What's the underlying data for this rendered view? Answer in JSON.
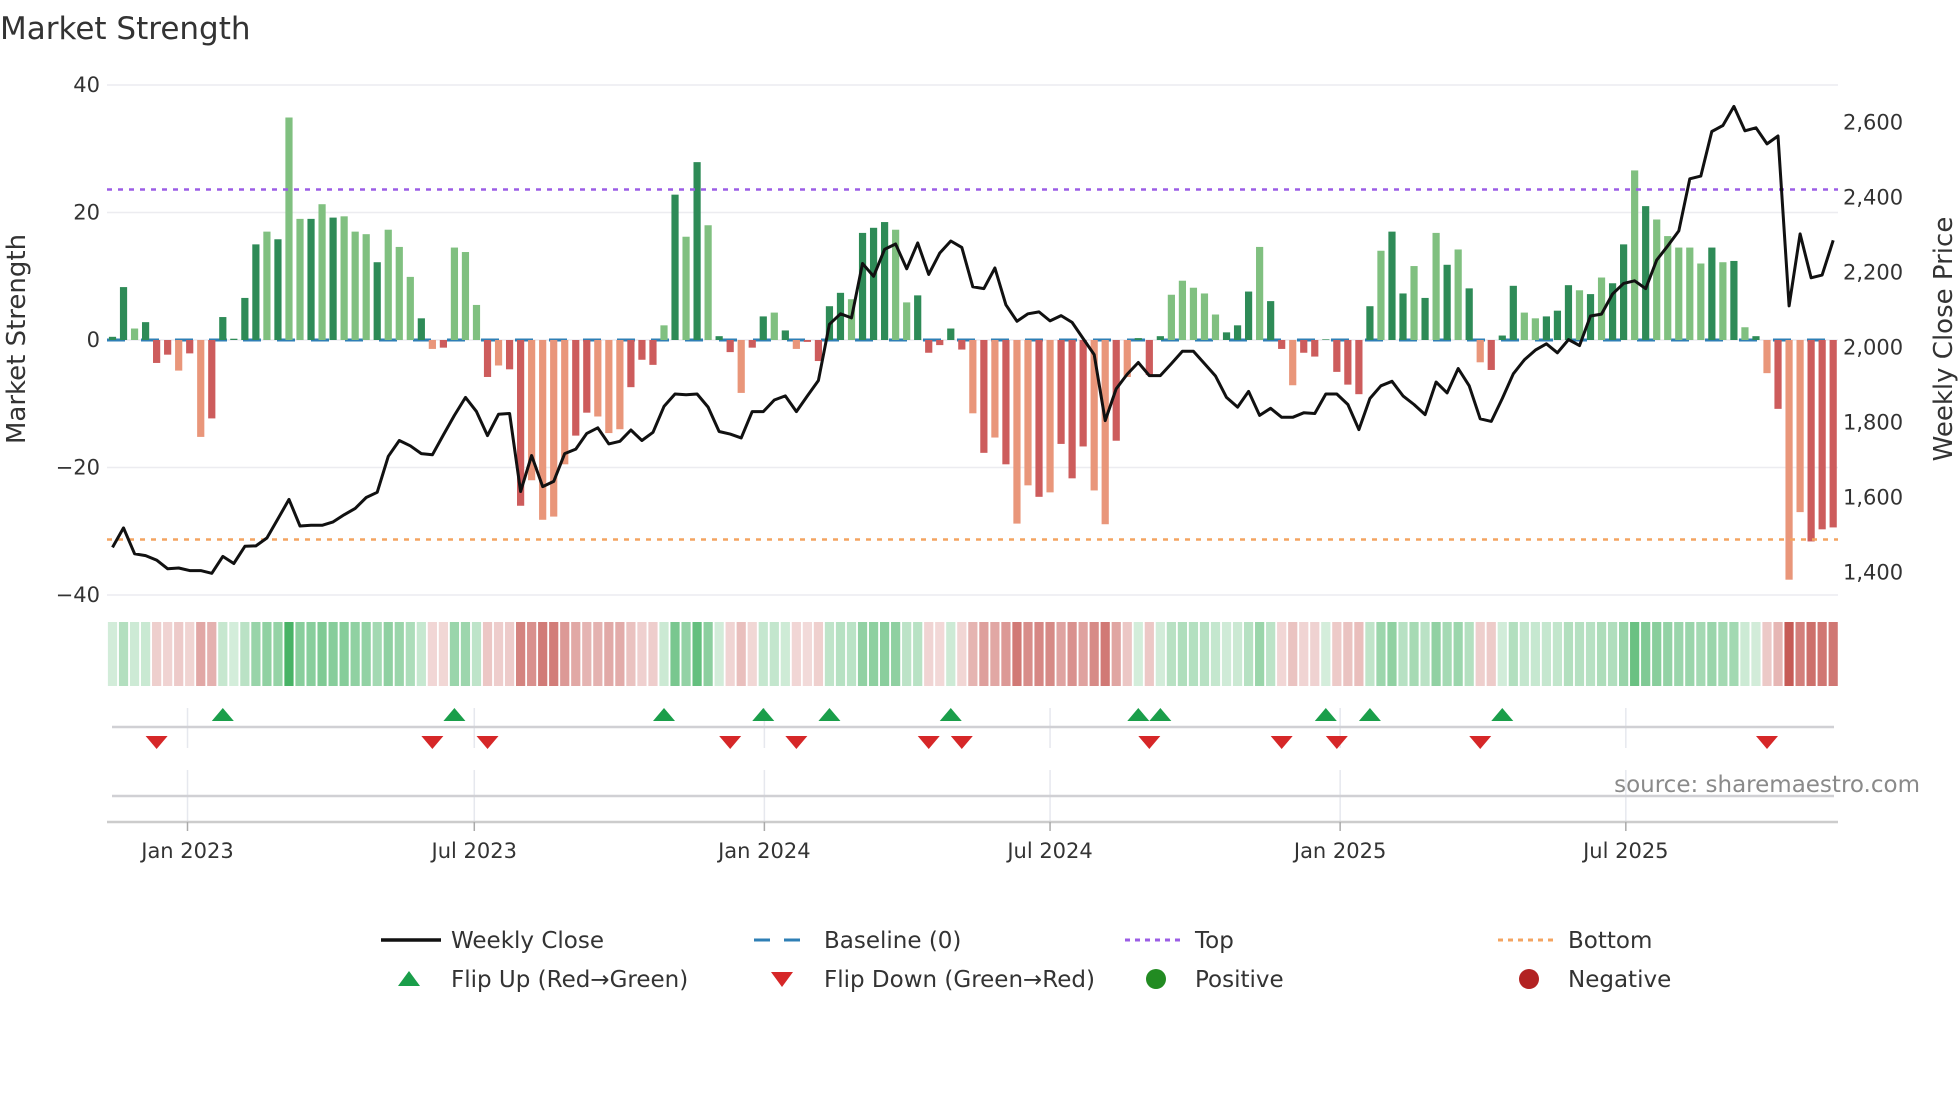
{
  "title": "Market Strength",
  "source": "source: sharemaestro.com",
  "colors": {
    "pos_dark": "#2e8b57",
    "pos_light": "#80c080",
    "neg_dark": "#cd5c5c",
    "neg_light": "#e9967a",
    "baseline": "#2f7fb5",
    "top": "#9b5de5",
    "bottom": "#f4a460",
    "line": "#111111",
    "flip_up": "#1a9e4a",
    "flip_down": "#d62728",
    "positive": "#228b22",
    "negative": "#b22222"
  },
  "chart_data": {
    "type": "bar+line",
    "title": "Market Strength",
    "ylabel": "Market Strength",
    "y2label": "Weekly Close Price",
    "ylim": [
      -40,
      40
    ],
    "y2lim": [
      1340,
      2700
    ],
    "yticks": [
      "40",
      "20",
      "0",
      "−20",
      "−40"
    ],
    "yticks_values": [
      40,
      20,
      0,
      -20,
      -40
    ],
    "y2ticks": [
      "2,600",
      "2,400",
      "2,200",
      "2,000",
      "1,800",
      "1,600",
      "1,400"
    ],
    "y2ticks_values": [
      2600,
      2400,
      2200,
      2000,
      1800,
      1600,
      1400
    ],
    "top": 23.6,
    "bottom": -31.3,
    "baseline": 0,
    "xticks": [
      {
        "label": "Jan 2023",
        "week": 6.8
      },
      {
        "label": "Jul 2023",
        "week": 32.8
      },
      {
        "label": "Jan 2024",
        "week": 59.1
      },
      {
        "label": "Jul 2024",
        "week": 85.0
      },
      {
        "label": "Jan 2025",
        "week": 111.3
      },
      {
        "label": "Jul 2025",
        "week": 137.2
      }
    ],
    "strength": [
      0.5,
      8.3,
      1.8,
      2.8,
      -3.6,
      -2.3,
      -4.8,
      -2.1,
      -15.2,
      -12.3,
      3.6,
      0.2,
      6.6,
      15,
      17,
      15.8,
      34.9,
      19,
      19,
      21.3,
      19.2,
      19.4,
      17,
      16.6,
      12.2,
      17.3,
      14.6,
      9.9,
      3.4,
      -1.4,
      -1.2,
      14.5,
      13.8,
      5.5,
      -5.8,
      -4,
      -4.6,
      -26,
      -22,
      -28.2,
      -27.7,
      -19.5,
      -15,
      -11.4,
      -12,
      -14.6,
      -14,
      -7.4,
      -3.1,
      -3.9,
      2.3,
      22.8,
      16.2,
      27.9,
      18,
      0.6,
      -1.9,
      -8.3,
      -1.2,
      3.7,
      4.3,
      1.5,
      -1.4,
      -0.3,
      -3.3,
      5.3,
      7.4,
      6.4,
      16.8,
      17.6,
      18.5,
      17.3,
      5.9,
      7,
      -2,
      -0.8,
      1.8,
      -1.5,
      -11.5,
      -17.7,
      -15.3,
      -19.5,
      -28.8,
      -22.8,
      -24.6,
      -23.9,
      -16.3,
      -21.7,
      -16.7,
      -23.6,
      -28.9,
      -15.8,
      -5.8,
      0.3,
      -5.5,
      0.6,
      7.1,
      9.3,
      8.2,
      7.3,
      4,
      1.2,
      2.3,
      7.6,
      14.6,
      6.1,
      -1.4,
      -7.1,
      -2,
      -2.6,
      0.1,
      -5,
      -7,
      -8.5,
      5.3,
      14,
      17,
      7.3,
      11.6,
      6.6,
      16.8,
      11.8,
      14.2,
      8.1,
      -3.5,
      -4.7,
      0.7,
      8.5,
      4.3,
      3.4,
      3.7,
      4.6,
      8.6,
      7.8,
      7.2,
      9.8,
      8.9,
      15,
      26.6,
      21,
      18.9,
      16.3,
      14.5,
      14.5,
      12,
      14.5,
      12.2,
      12.4,
      2,
      0.6,
      -5.2,
      -10.8,
      -37.6,
      -27,
      -31.6,
      -29.7,
      -29.4
    ],
    "shade": "ddldddldldddddldlldldllldllldldllldlddllllddllldddldldlddlddldlddddldddlldddddldldlldldddlldldddllllldddlddldddddddlddldldldldddlldddldlddldllllldldldldllddddldll",
    "weekly_close": [
      1467,
      1519,
      1450,
      1445,
      1433,
      1410,
      1412,
      1405,
      1405,
      1398,
      1443,
      1424,
      1470,
      1471,
      1492,
      1543,
      1595,
      1524,
      1526,
      1526,
      1535,
      1554,
      1571,
      1600,
      1614,
      1710,
      1752,
      1738,
      1717,
      1714,
      1767,
      1819,
      1867,
      1829,
      1765,
      1822,
      1824,
      1616,
      1712,
      1629,
      1643,
      1717,
      1729,
      1771,
      1786,
      1743,
      1750,
      1780,
      1752,
      1774,
      1843,
      1876,
      1874,
      1876,
      1841,
      1776,
      1769,
      1759,
      1829,
      1829,
      1860,
      1871,
      1829,
      1871,
      1912,
      2062,
      2090,
      2079,
      2224,
      2190,
      2262,
      2276,
      2210,
      2279,
      2195,
      2252,
      2284,
      2267,
      2162,
      2157,
      2212,
      2114,
      2070,
      2090,
      2095,
      2071,
      2085,
      2067,
      2024,
      1981,
      1805,
      1890,
      1929,
      1960,
      1925,
      1925,
      1957,
      1990,
      1990,
      1957,
      1924,
      1867,
      1841,
      1883,
      1819,
      1838,
      1814,
      1814,
      1826,
      1824,
      1876,
      1876,
      1848,
      1781,
      1864,
      1898,
      1910,
      1871,
      1848,
      1821,
      1908,
      1879,
      1944,
      1898,
      1810,
      1803,
      1864,
      1930,
      1967,
      1993,
      2010,
      1986,
      2021,
      2005,
      2084,
      2089,
      2143,
      2171,
      2178,
      2157,
      2233,
      2271,
      2311,
      2450,
      2457,
      2576,
      2592,
      2643,
      2578,
      2586,
      2543,
      2564,
      2111,
      2303,
      2186,
      2193,
      2286
    ],
    "flip_up_weeks": [
      10,
      31,
      50,
      59,
      65,
      76,
      93,
      95,
      110,
      114,
      126
    ],
    "flip_down_weeks": [
      4,
      29,
      34,
      56,
      62,
      74,
      77,
      94,
      106,
      111,
      124,
      150
    ]
  },
  "legend": [
    {
      "label": "Weekly Close",
      "kind": "line"
    },
    {
      "label": "Baseline (0)",
      "kind": "dash"
    },
    {
      "label": "Top",
      "kind": "dot-top"
    },
    {
      "label": "Bottom",
      "kind": "dot-bottom"
    },
    {
      "label": "Flip Up (Red→Green)",
      "kind": "tri-up"
    },
    {
      "label": "Flip Down (Green→Red)",
      "kind": "tri-down"
    },
    {
      "label": "Positive",
      "kind": "dot-pos"
    },
    {
      "label": "Negative",
      "kind": "dot-neg"
    }
  ]
}
